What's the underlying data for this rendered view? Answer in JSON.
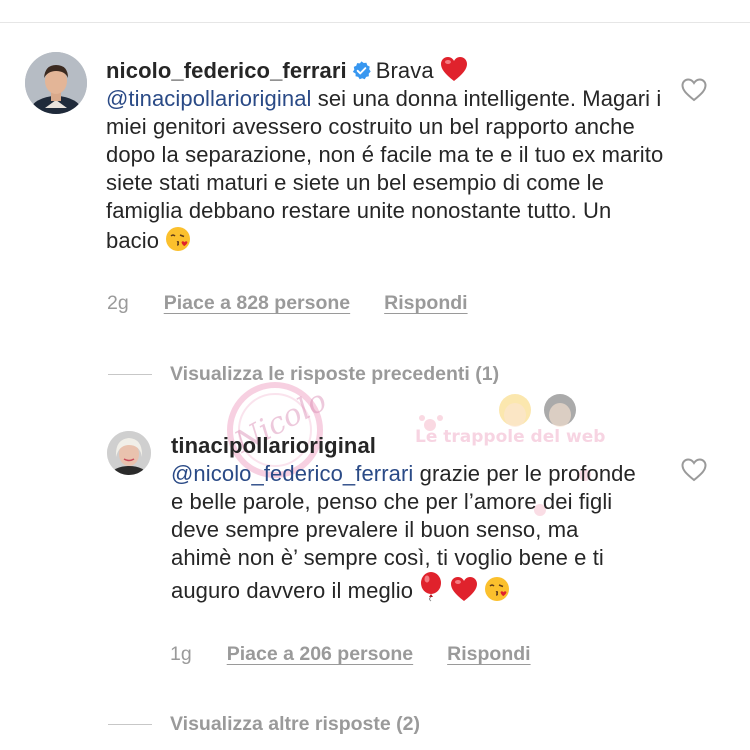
{
  "comment": {
    "username": "nicolo_federico_ferrari",
    "verified_icon": "verified-badge-icon",
    "text_intro": "Brava",
    "mention": "@tinacipollarioriginal",
    "text_body": " sei una donna intelligente. Magari i miei genitori avessero costruito un bel rapporto anche dopo la separazione, non é facile ma te e il tuo ex marito siete stati maturi e siete un bel esempio di come le famiglia debbano restare unite nonostante tutto. Un bacio",
    "time": "2g",
    "likes": "Piace a 828 persone",
    "reply_label": "Rispondi"
  },
  "view_previous_replies": "Visualizza le risposte precedenti (1)",
  "reply": {
    "username": "tinacipollarioriginal",
    "mention": "@nicolo_federico_ferrari",
    "text_body": " grazie per le profonde e belle parole, penso che per l’amore dei figli deve sempre prevalere il buon senso, ma ahimè non è’ sempre così, ti voglio bene e ti auguro davvero il meglio",
    "time": "1g",
    "likes": "Piace a 206 persone",
    "reply_label": "Rispondi"
  },
  "view_more_replies": "Visualizza altre risposte (2)",
  "watermark_text": "Nicolo",
  "watermark_text2": "Le trappole del web",
  "colors": {
    "text": "#262626",
    "mention": "#2a4a86",
    "meta": "#9a9a9a",
    "verified": "#3897f0",
    "heart_red": "#e0222c"
  }
}
